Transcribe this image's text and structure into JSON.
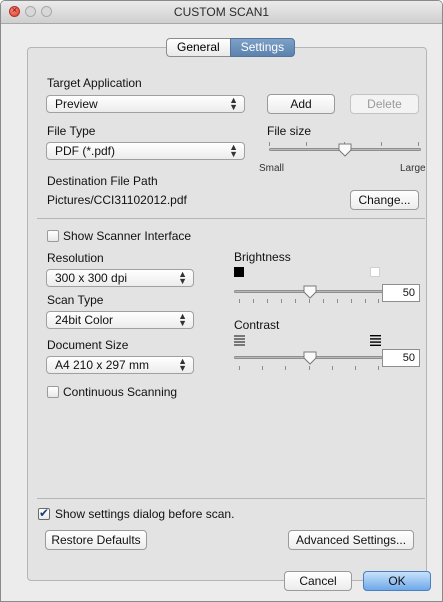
{
  "window": {
    "title": "CUSTOM SCAN1"
  },
  "tabs": [
    {
      "label": "General"
    },
    {
      "label": "Settings"
    }
  ],
  "target_app": {
    "label": "Target Application",
    "value": "Preview",
    "add": "Add",
    "delete": "Delete"
  },
  "file_type": {
    "label": "File Type",
    "value": "PDF (*.pdf)"
  },
  "file_size": {
    "label": "File size",
    "small": "Small",
    "large": "Large",
    "level": 0.6
  },
  "destination": {
    "label": "Destination File Path",
    "value": "Pictures/CCI31102012.pdf",
    "change": "Change..."
  },
  "scanner_interface": {
    "label": "Show Scanner Interface",
    "checked": false
  },
  "resolution": {
    "label": "Resolution",
    "value": "300 x 300 dpi"
  },
  "scan_type": {
    "label": "Scan Type",
    "value": "24bit Color"
  },
  "document_size": {
    "label": "Document Size",
    "value": "A4 210 x 297 mm"
  },
  "continuous": {
    "label": "Continuous Scanning",
    "checked": false
  },
  "brightness": {
    "label": "Brightness",
    "value": "50",
    "icon_low": "black-square-icon",
    "icon_high": "white-square-icon"
  },
  "contrast": {
    "label": "Contrast",
    "value": "50",
    "icon_low": "contrast-low-icon",
    "icon_high": "contrast-high-icon"
  },
  "show_settings": {
    "label": "Show settings dialog before scan.",
    "checked": true
  },
  "restore": "Restore Defaults",
  "advanced": "Advanced Settings...",
  "cancel": "Cancel",
  "ok": "OK"
}
